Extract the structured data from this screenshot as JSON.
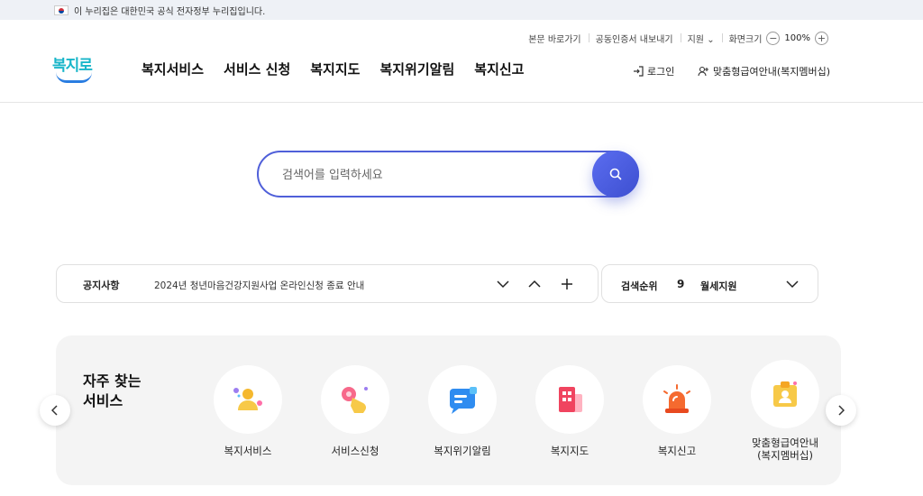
{
  "gov_banner": {
    "text": "이 누리집은 대한민국 공식 전자정부 누리집입니다."
  },
  "utility": {
    "skip": "본문 바로가기",
    "cert": "공동인증서 내보내기",
    "lang": "지원",
    "zoom_label": "화면크기",
    "zoom_value": "100%",
    "zoom_minus": "−",
    "zoom_plus": "+"
  },
  "logo": {
    "text": "복지로"
  },
  "gnb": [
    "복지서비스",
    "서비스 신청",
    "복지지도",
    "복지위기알림",
    "복지신고"
  ],
  "header_right": {
    "login": "로그인",
    "custom": "맞춤형급여안내(복지멤버십)"
  },
  "search": {
    "placeholder": "검색어를 입력하세요"
  },
  "notice": {
    "label": "공지사항",
    "text": "2024년 청년마음건강지원사업 온라인신청 종료 안내"
  },
  "rank": {
    "label": "검색순위",
    "number": "9",
    "text": "월세지원"
  },
  "frequent": {
    "title_line1": "자주 찾는",
    "title_line2": "서비스",
    "items": [
      {
        "label": "복지서비스",
        "icon": "people-icon"
      },
      {
        "label": "서비스신청",
        "icon": "hand-click-icon"
      },
      {
        "label": "복지위기알림",
        "icon": "message-icon"
      },
      {
        "label": "복지지도",
        "icon": "map-building-icon"
      },
      {
        "label": "복지신고",
        "icon": "siren-icon"
      },
      {
        "label_line1": "맞춤형급여안내",
        "label_line2": "(복지멤버십)",
        "icon": "id-badge-icon"
      }
    ]
  },
  "colors": {
    "accent": "#4f5fd9",
    "logo": "#19b6c9"
  }
}
